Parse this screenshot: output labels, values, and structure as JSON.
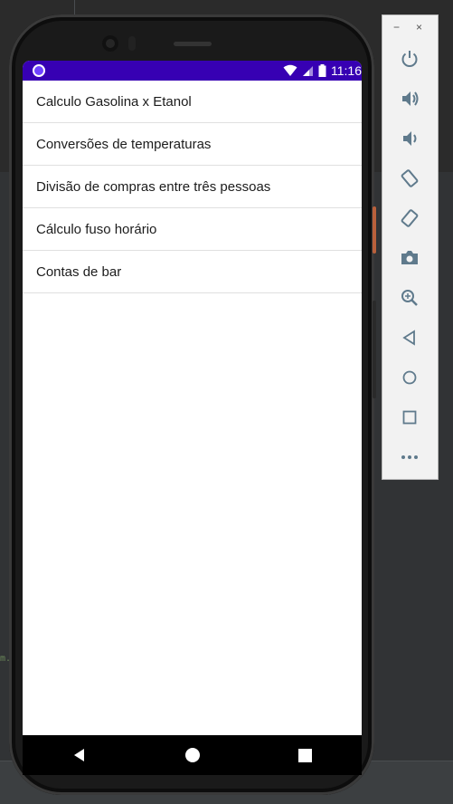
{
  "statusbar": {
    "time": "11:16"
  },
  "list": {
    "items": [
      {
        "label": "Calculo Gasolina x Etanol"
      },
      {
        "label": "Conversões de temperaturas"
      },
      {
        "label": "Divisão de compras entre três pessoas"
      },
      {
        "label": "Cálculo fuso horário"
      },
      {
        "label": "Contas de bar"
      }
    ]
  },
  "toolbar": {
    "minimize": "−",
    "close": "×",
    "icons": [
      "power-icon",
      "volume-up-icon",
      "volume-down-icon",
      "rotate-left-icon",
      "rotate-right-icon",
      "camera-icon",
      "zoom-icon",
      "back-icon",
      "home-icon",
      "overview-icon",
      "more-icon"
    ]
  },
  "colors": {
    "statusbar": "#3700b3",
    "accent_button": "#b9603b",
    "icon": "#5f7a8c"
  }
}
